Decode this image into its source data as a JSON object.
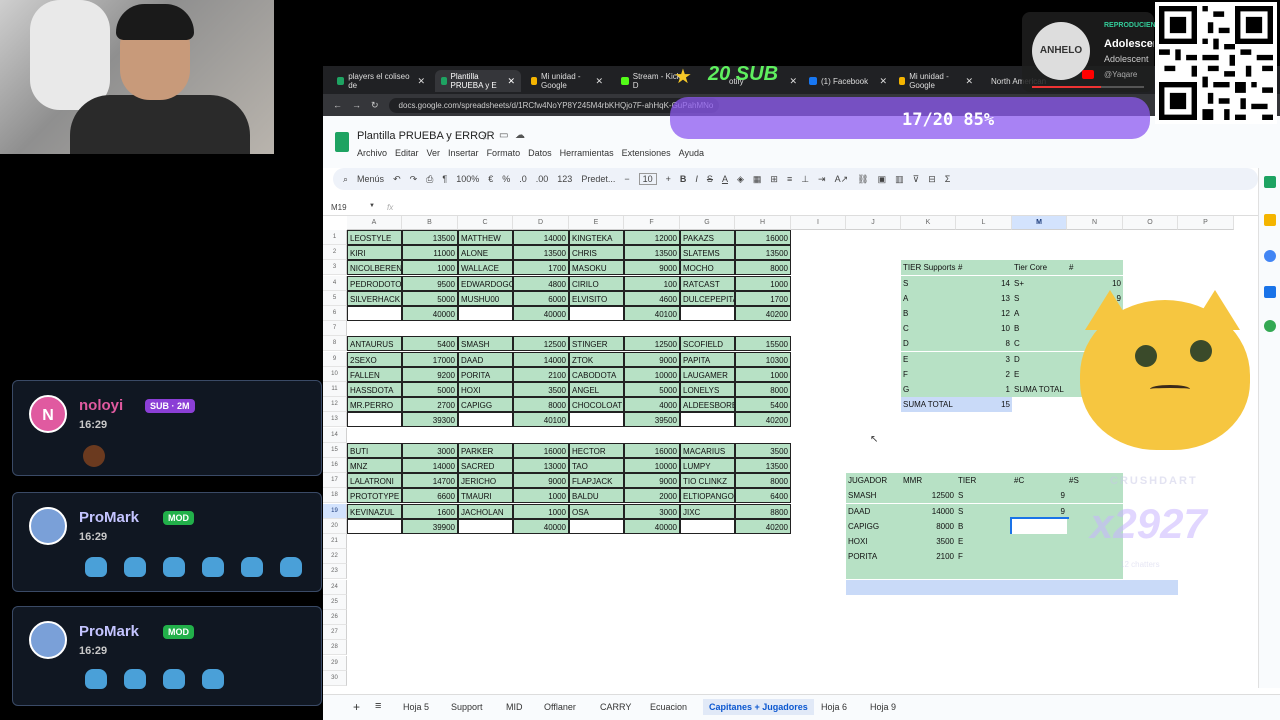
{
  "chat": [
    {
      "user": "noloyi",
      "badge": "SUB · 2M",
      "time": "16:29",
      "initial": "N",
      "color": "#e05aa0"
    },
    {
      "user": "ProMark",
      "badge": "MOD",
      "time": "16:29",
      "color": "#b5b5ff"
    },
    {
      "user": "ProMark",
      "badge": "MOD",
      "time": "16:29",
      "color": "#b5b5ff"
    }
  ],
  "browser": {
    "tabs": [
      "players el coliseo de",
      "Plantilla PRUEBA y E",
      "Mi unidad - Google",
      "Stream - Kick D",
      "otify",
      "(1) Facebook",
      "Mi unidad - Google",
      "North American"
    ],
    "url": "docs.google.com/spreadsheets/d/1RCfw4NoYP8Y245M4rbKHQjo7F-ahHqK-GuPahMNo"
  },
  "sheet": {
    "title": "Plantilla PRUEBA y ERROR",
    "menus": [
      "Archivo",
      "Editar",
      "Ver",
      "Insertar",
      "Formato",
      "Datos",
      "Herramientas",
      "Extensiones",
      "Ayuda"
    ],
    "toolbar": {
      "search": "Menús",
      "zoom": "100%",
      "euro": "€",
      "pct": "%",
      "dec1": ".0",
      "dec2": ".00",
      "fmt": "123",
      "font": "Predet...",
      "size": "10"
    },
    "namebox": "M19",
    "fx": "fx",
    "columns": [
      "A",
      "B",
      "C",
      "D",
      "E",
      "F",
      "G",
      "H",
      "I",
      "J",
      "K",
      "L",
      "M",
      "N",
      "O",
      "P"
    ],
    "rows": [
      "1",
      "2",
      "3",
      "4",
      "5",
      "6",
      "7",
      "8",
      "9",
      "10",
      "11",
      "12",
      "13",
      "14",
      "15",
      "16",
      "17",
      "18",
      "19",
      "20",
      "21",
      "22",
      "23",
      "24",
      "25",
      "26",
      "27",
      "28",
      "29",
      "30"
    ],
    "tabs": [
      "Hoja 5",
      "Support",
      "MID",
      "Offlaner",
      "CARRY",
      "Ecuacion",
      "Capitanes + Jugadores",
      "Hoja 6",
      "Hoja 9"
    ],
    "active_tab": "Capitanes + Jugadores",
    "block1": [
      [
        "LEOSTYLE",
        "13500",
        "MATTHEW",
        "14000",
        "KINGTEKA",
        "12000",
        "PAKAZS",
        "16000"
      ],
      [
        "KIRI",
        "11000",
        "ALONE",
        "13500",
        "CHRIS",
        "13500",
        "SLATEMS",
        "13500"
      ],
      [
        "NICOLBERENIC",
        "1000",
        "WALLACE",
        "1700",
        "MASOKU",
        "9000",
        "MOCHO",
        "8000"
      ],
      [
        "PEDRODOTO",
        "9500",
        "EDWARDOGG",
        "4800",
        "CIRILO",
        "100",
        "RATCAST",
        "1000"
      ],
      [
        "SILVERHACK",
        "5000",
        "MUSHU00",
        "6000",
        "ELVISITO",
        "4600",
        "DULCEPEPITA",
        "1700"
      ],
      [
        "",
        "40000",
        "",
        "40000",
        "",
        "40100",
        "",
        "40200"
      ]
    ],
    "block2": [
      [
        "ANTAURUS",
        "5400",
        "SMASH",
        "12500",
        "STINGER",
        "12500",
        "SCOFIELD",
        "15500"
      ],
      [
        "2SEXO",
        "17000",
        "DAAD",
        "14000",
        "ZTOK",
        "9000",
        "PAPITA",
        "10300"
      ],
      [
        "FALLEN",
        "9200",
        "PORITA",
        "2100",
        "CABODOTA",
        "10000",
        "LAUGAMER",
        "1000"
      ],
      [
        "HASSDOTA",
        "5000",
        "HOXI",
        "3500",
        "ANGEL",
        "5000",
        "LONELYS",
        "8000"
      ],
      [
        "MR.PERRO",
        "2700",
        "CAPIGG",
        "8000",
        "CHOCOLOAT",
        "4000",
        "ALDEESBOREI",
        "5400"
      ],
      [
        "",
        "39300",
        "",
        "40100",
        "",
        "39500",
        "",
        "40200"
      ]
    ],
    "block3": [
      [
        "BUTI",
        "3000",
        "PARKER",
        "16000",
        "HECTOR",
        "16000",
        "MACARIUS",
        "3500"
      ],
      [
        "MNZ",
        "14000",
        "SACRED",
        "13000",
        "TAO",
        "10000",
        "LUMPY",
        "13500"
      ],
      [
        "LALATRONI",
        "14700",
        "JERICHO",
        "9000",
        "FLAPJACK",
        "9000",
        "TIO CLINKZ",
        "8000"
      ],
      [
        "PROTOTYPE",
        "6600",
        "TMAURI",
        "1000",
        "BALDU",
        "2000",
        "ELTIOPANGO",
        "6400"
      ],
      [
        "KEVINAZUL",
        "1600",
        "JACHOLAN",
        "1000",
        "OSA",
        "3000",
        "JIXC",
        "8800"
      ],
      [
        "",
        "39900",
        "",
        "40000",
        "",
        "40000",
        "",
        "40200"
      ]
    ],
    "tier_supports": {
      "header": [
        "TIER Supports",
        "#"
      ],
      "rows": [
        [
          "S",
          "14"
        ],
        [
          "A",
          "13"
        ],
        [
          "B",
          "12"
        ],
        [
          "C",
          "10"
        ],
        [
          "D",
          "8"
        ],
        [
          "E",
          "3"
        ],
        [
          "F",
          "2"
        ],
        [
          "G",
          "1"
        ]
      ],
      "total": [
        "SUMA TOTAL",
        "15"
      ]
    },
    "tier_core": {
      "header": [
        "Tier Core",
        "#"
      ],
      "rows": [
        [
          "S+",
          "10"
        ],
        [
          "S",
          "9"
        ],
        [
          "A",
          ""
        ],
        [
          "B",
          ""
        ],
        [
          "C",
          ""
        ],
        [
          "D",
          ""
        ],
        [
          "E",
          ""
        ],
        [
          "SUMA TOTAL",
          ""
        ]
      ]
    },
    "jugadores": {
      "header": [
        "JUGADOR",
        "MMR",
        "TIER",
        "#C",
        "#S"
      ],
      "rows": [
        [
          "SMASH",
          "12500",
          "S",
          "9",
          ""
        ],
        [
          "DAAD",
          "14000",
          "S",
          "9",
          ""
        ],
        [
          "CAPIGG",
          "8000",
          "B",
          "",
          ""
        ],
        [
          "HOXI",
          "3500",
          "E",
          "",
          ""
        ],
        [
          "PORITA",
          "2100",
          "F",
          "",
          ""
        ]
      ]
    }
  },
  "overlays": {
    "sub_goal": "20 SUB",
    "sub_progress": "17/20 85%",
    "progress": 0.85,
    "music_label": "REPRODUCIENDO",
    "music_title": "Adolescent",
    "music_sub": "Adolescent",
    "music_author": "@Yaqare",
    "music_cover": "ANHELO",
    "combo": "x2927",
    "combo_label": "CRUSHDART",
    "combo_sub": "12 chatters"
  }
}
